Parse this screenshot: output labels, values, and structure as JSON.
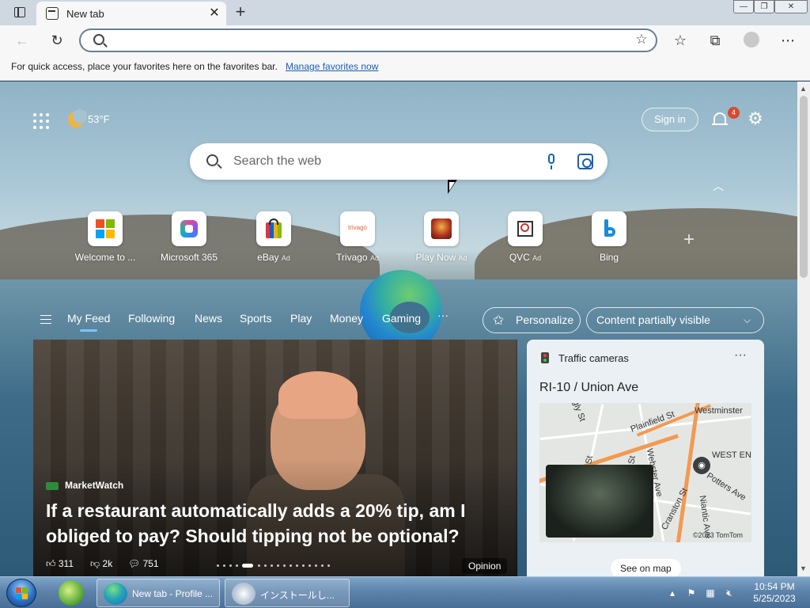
{
  "browser": {
    "tab_title": "New tab",
    "tab_close": "✕",
    "new_tab": "+",
    "window_buttons": [
      "—",
      "❐",
      "✕"
    ],
    "address_placeholder": "",
    "favorites_message": "For quick access, place your favorites here on the favorites bar.",
    "favorites_link": "Manage favorites now",
    "toolbar_icons": [
      "back-icon",
      "refresh-icon",
      "favorites-icon",
      "collections-icon",
      "profile-icon",
      "more-icon"
    ]
  },
  "page": {
    "weather_temp": "53°F",
    "sign_in": "Sign in",
    "notifications_count": "4",
    "search_placeholder": "Search the web",
    "quick_links": [
      {
        "label": "Welcome to ...",
        "ad": ""
      },
      {
        "label": "Microsoft 365",
        "ad": ""
      },
      {
        "label": "eBay",
        "ad": "Ad"
      },
      {
        "label": "Trivago",
        "ad": "Ad"
      },
      {
        "label": "Play Now",
        "ad": "Ad"
      },
      {
        "label": "QVC",
        "ad": "Ad"
      },
      {
        "label": "Bing",
        "ad": ""
      }
    ],
    "trivago_logo_text": "trivago",
    "feed_nav": [
      "My Feed",
      "Following",
      "News",
      "Sports",
      "Play",
      "Money",
      "Gaming",
      "···"
    ],
    "personalize": "Personalize",
    "content_visibility": "Content partially visible",
    "story": {
      "source": "MarketWatch",
      "headline": "If a restaurant automatically adds a 20% tip, am I obliged to pay? Should tipping not be optional?",
      "likes": "311",
      "dislikes": "2k",
      "comments": "751",
      "tag": "Opinion"
    },
    "traffic": {
      "title": "Traffic cameras",
      "more": "···",
      "location": "RI-10 / Union Ave",
      "map_labels": [
        "Westminster",
        "Plainfield St",
        "WEST EN",
        "Potters Ave",
        "Webster Ave",
        "Cranston St",
        "Niantic Ave",
        "gly St",
        "St",
        "St"
      ],
      "copyright": "©2023 TomTom",
      "see_on_map": "See on map"
    }
  },
  "taskbar": {
    "apps": [
      {
        "label": "New tab - Profile ..."
      },
      {
        "label": "インストールし..."
      }
    ],
    "time": "10:54 PM",
    "date": "5/25/2023"
  },
  "colors": {
    "accent": "#1a5fb4",
    "badge": "#d84a2e",
    "taskbar": "#5d83ab"
  }
}
